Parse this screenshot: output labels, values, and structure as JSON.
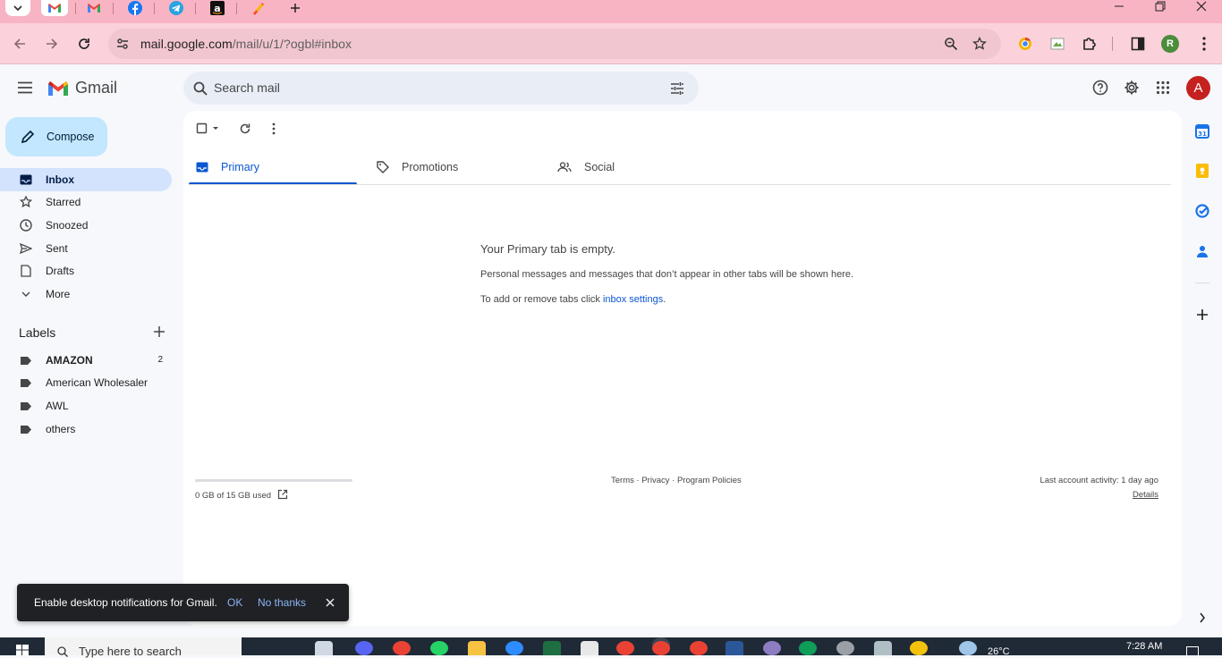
{
  "browser": {
    "tabs": [
      {
        "icon": "tab-list-icon",
        "active": false
      },
      {
        "icon": "gmail-icon",
        "active": true
      },
      {
        "icon": "gmail-icon",
        "active": false
      },
      {
        "icon": "facebook-icon",
        "active": false
      },
      {
        "icon": "telegram-icon",
        "active": false
      },
      {
        "icon": "amazon-icon",
        "active": false
      },
      {
        "icon": "app-icon",
        "active": false
      }
    ],
    "url_host": "mail.google.com",
    "url_path": "/mail/u/1/?ogbl#inbox",
    "profile_initial": "R",
    "colors": {
      "tabstrip": "#f9b4c4",
      "toolbar": "#fbd2dc",
      "omnibox": "#f2c6d0"
    }
  },
  "header": {
    "app_name": "Gmail",
    "search_placeholder": "Search mail",
    "avatar_initial": "A"
  },
  "compose": {
    "label": "Compose"
  },
  "nav": [
    {
      "label": "Inbox",
      "icon": "inbox-icon",
      "active": true
    },
    {
      "label": "Starred",
      "icon": "star-icon"
    },
    {
      "label": "Snoozed",
      "icon": "clock-icon"
    },
    {
      "label": "Sent",
      "icon": "send-icon"
    },
    {
      "label": "Drafts",
      "icon": "draft-icon"
    },
    {
      "label": "More",
      "icon": "chevron-down-icon"
    }
  ],
  "labels": {
    "heading": "Labels",
    "items": [
      {
        "label": "AMAZON",
        "count": "2",
        "bold": true
      },
      {
        "label": "American Wholesaler",
        "count": ""
      },
      {
        "label": "AWL",
        "count": ""
      },
      {
        "label": "others",
        "count": ""
      }
    ]
  },
  "tabs": [
    {
      "label": "Primary",
      "icon": "inbox-icon",
      "active": true
    },
    {
      "label": "Promotions",
      "icon": "tag-icon"
    },
    {
      "label": "Social",
      "icon": "people-icon"
    }
  ],
  "empty_state": {
    "title": "Your Primary tab is empty.",
    "line1": "Personal messages and messages that don’t appear in other tabs will be shown here.",
    "line2_prefix": "To add or remove tabs click ",
    "line2_link": "inbox settings",
    "line2_suffix": "."
  },
  "footer": {
    "storage_used": "0 GB of 15 GB used",
    "storage_fraction": 0,
    "terms": "Terms",
    "privacy": "Privacy",
    "policies": "Program Policies",
    "sep": "·",
    "last_activity": "Last account activity: 1 day ago",
    "details": "Details"
  },
  "snackbar": {
    "message": "Enable desktop notifications for Gmail.",
    "ok": "OK",
    "no_thanks": "No thanks"
  },
  "taskbar": {
    "search_placeholder": "Type here to search",
    "temperature": "26°C",
    "time": "7:28 AM"
  }
}
